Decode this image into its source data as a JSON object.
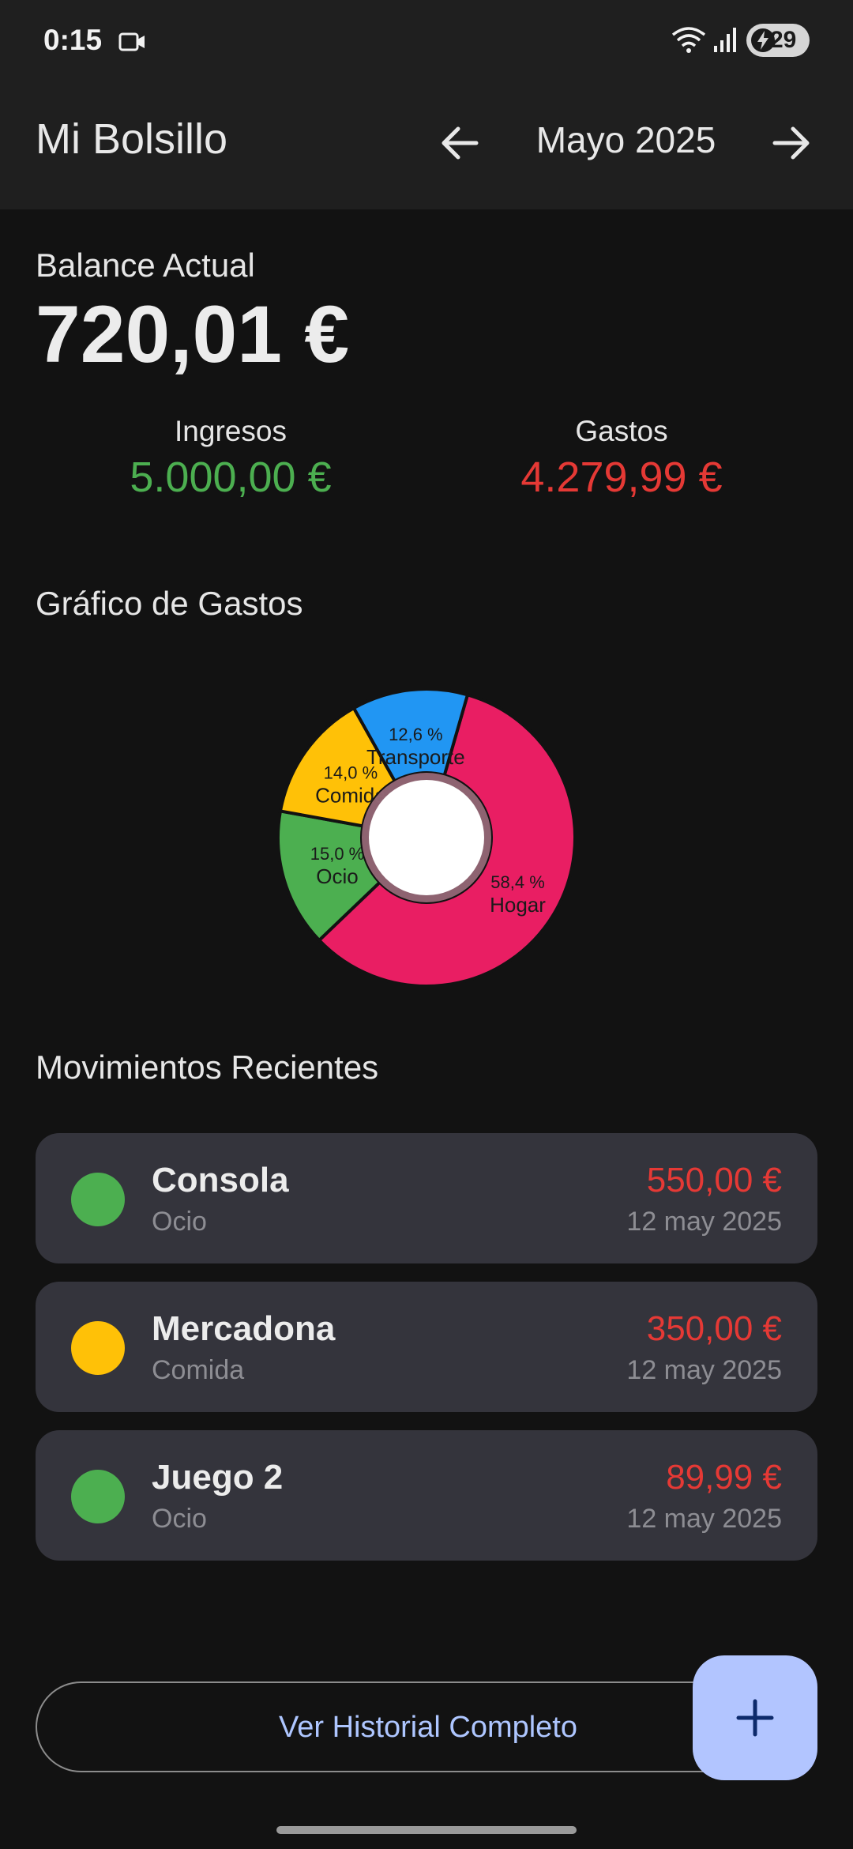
{
  "status_bar": {
    "time": "0:15",
    "battery": "29",
    "icons": [
      "screen-record-icon",
      "wifi-icon",
      "signal-icon",
      "battery-charging-icon"
    ]
  },
  "app_bar": {
    "title": "Mi Bolsillo",
    "month": "Mayo 2025",
    "prev_icon": "arrow-left-icon",
    "next_icon": "arrow-right-icon"
  },
  "balance": {
    "label": "Balance Actual",
    "value": "720,01 €"
  },
  "summary": {
    "income_label": "Ingresos",
    "income_value": "5.000,00 €",
    "expense_label": "Gastos",
    "expense_value": "4.279,99 €"
  },
  "chart_section": {
    "title": "Gráfico de Gastos"
  },
  "chart_data": {
    "type": "pie",
    "donut": true,
    "slices": [
      {
        "label": "Hogar",
        "value": 58.4,
        "percent_label": "58,4 %",
        "color": "#e91e63"
      },
      {
        "label": "Ocio",
        "value": 15.0,
        "percent_label": "15,0 %",
        "color": "#4caf50"
      },
      {
        "label": "Comida",
        "value": 14.0,
        "percent_label": "14,0 %",
        "color": "#ffc107"
      },
      {
        "label": "Transporte",
        "value": 12.6,
        "percent_label": "12,6 %",
        "color": "#2196f3"
      }
    ]
  },
  "recent": {
    "title": "Movimientos Recientes",
    "items": [
      {
        "name": "Consola",
        "category": "Ocio",
        "amount": "550,00 €",
        "date": "12 may 2025",
        "color": "#4caf50"
      },
      {
        "name": "Mercadona",
        "category": "Comida",
        "amount": "350,00 €",
        "date": "12 may 2025",
        "color": "#ffc107"
      },
      {
        "name": "Juego 2",
        "category": "Ocio",
        "amount": "89,99 €",
        "date": "12 may 2025",
        "color": "#4caf50"
      }
    ]
  },
  "history_button": {
    "label": "Ver Historial Completo"
  },
  "fab": {
    "icon": "plus-icon"
  },
  "colors": {
    "income": "#4caf50",
    "expense": "#e53935",
    "accent": "#b2c5ff"
  }
}
